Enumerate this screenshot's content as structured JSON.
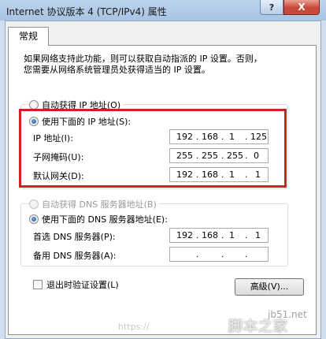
{
  "window": {
    "title": "Internet 协议版本 4 (TCP/IPv4) 属性",
    "help_glyph": "?",
    "close_glyph": "X"
  },
  "tabs": [
    {
      "label": "常规",
      "selected": true
    }
  ],
  "description": {
    "line1": "如果网络支持此功能，则可以获取自动指派的 IP 设置。否则，",
    "line2": "您需要从网络系统管理员处获得适当的 IP 设置。"
  },
  "ip_section": {
    "auto_label": "自动获得 IP 地址(O)",
    "manual_label": "使用下面的 IP 地址(S):",
    "selected": "manual",
    "fields": [
      {
        "label": "IP 地址(I):",
        "octets": [
          "192",
          "168",
          "1",
          "125"
        ]
      },
      {
        "label": "子网掩码(U):",
        "octets": [
          "255",
          "255",
          "255",
          "0"
        ]
      },
      {
        "label": "默认网关(D):",
        "octets": [
          "192",
          "168",
          "1",
          "1"
        ]
      }
    ]
  },
  "dns_section": {
    "auto_label": "自动获得 DNS 服务器地址(B)",
    "manual_label": "使用下面的 DNS 服务器地址(E):",
    "selected": "manual",
    "fields": [
      {
        "label": "首选 DNS 服务器(P):",
        "octets": [
          "192",
          "168",
          "1",
          "1"
        ]
      },
      {
        "label": "备用 DNS 服务器(A):",
        "octets": [
          "",
          "",
          "",
          ""
        ]
      }
    ]
  },
  "validate_checkbox": {
    "label": "退出时验证设置(L)",
    "checked": false
  },
  "advanced_button": {
    "label": "高级(V)..."
  },
  "watermark": {
    "site": "jb51.net",
    "url": "https://",
    "logo": "脚本之家"
  },
  "colors": {
    "highlight": "#d21f1f",
    "title_gradient": "#bcd3ec",
    "close_red": "#c7463a"
  }
}
